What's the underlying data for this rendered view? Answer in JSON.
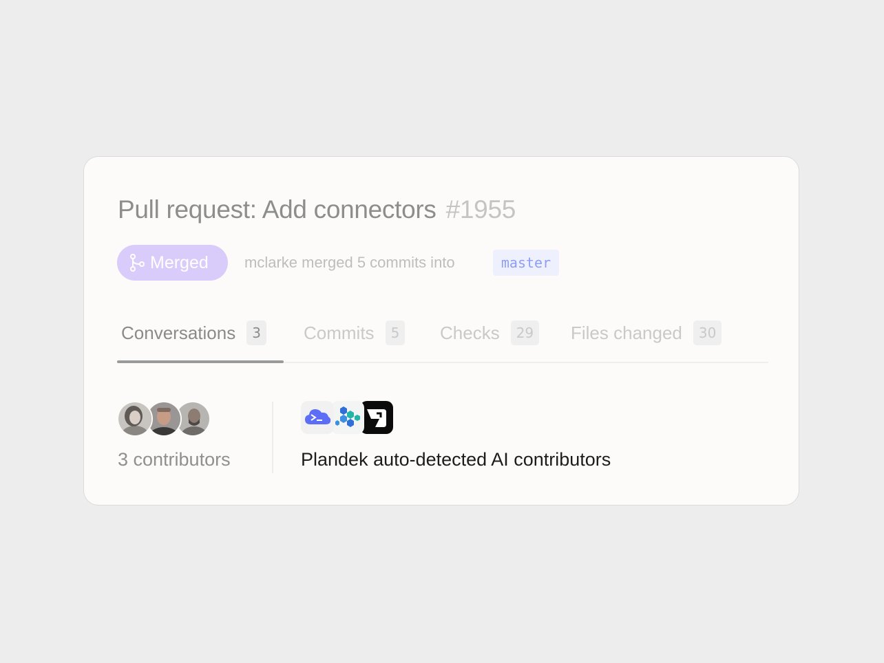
{
  "pr": {
    "title": "Pull request: Add connectors",
    "number": "#1955",
    "status_label": "Merged",
    "meta": "mclarke merged 5 commits into",
    "branch": "master"
  },
  "tabs": [
    {
      "label": "Conversations",
      "count": "3",
      "active": true
    },
    {
      "label": "Commits",
      "count": "5",
      "active": false
    },
    {
      "label": "Checks",
      "count": "29",
      "active": false
    },
    {
      "label": "Files changed",
      "count": "30",
      "active": false
    }
  ],
  "contributors": {
    "label": "3 contributors",
    "avatars": [
      "avatar-woman",
      "avatar-man-bald",
      "avatar-man-beard"
    ]
  },
  "ai": {
    "label": "Plandek auto-detected AI contributors",
    "icons": [
      "terminal-cloud-icon",
      "hexagon-cluster-icon",
      "arrow-logo-icon"
    ]
  },
  "colors": {
    "merged_pill": "#d9ccfb",
    "branch_text": "#8d9df4",
    "branch_bg": "#eef1fd"
  }
}
